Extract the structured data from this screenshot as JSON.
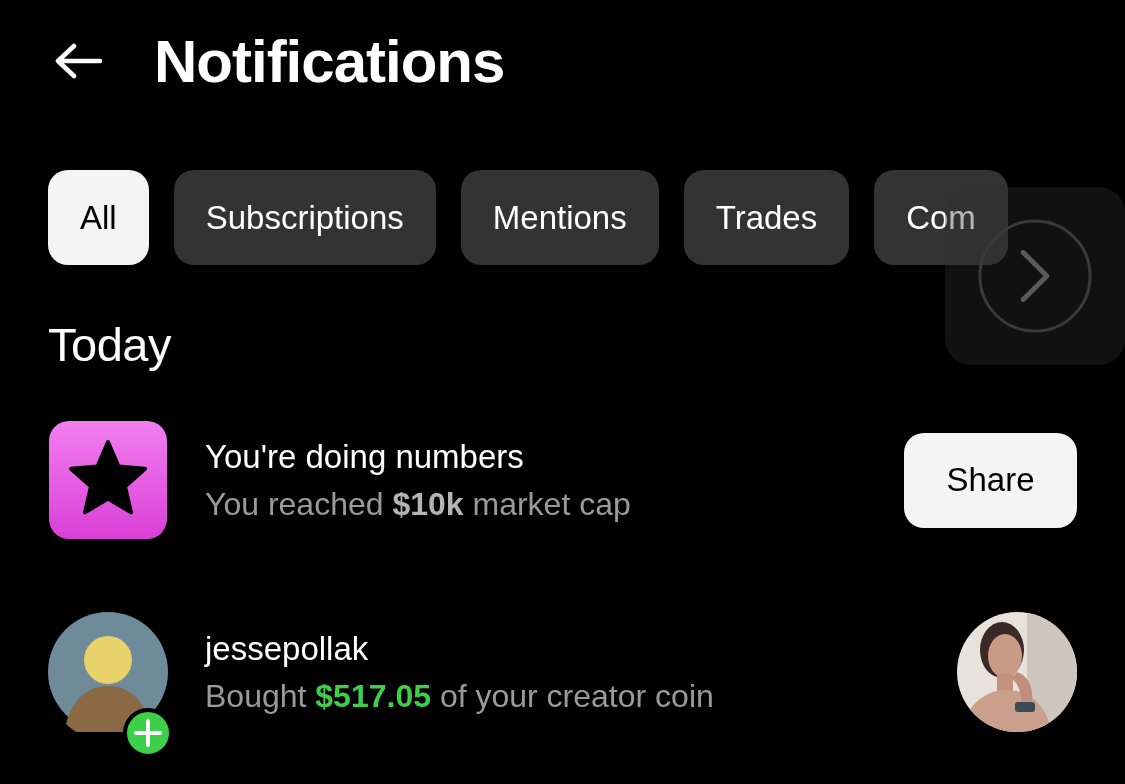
{
  "header": {
    "title": "Notifications"
  },
  "tabs": [
    {
      "label": "All",
      "selected": true
    },
    {
      "label": "Subscriptions",
      "selected": false
    },
    {
      "label": "Mentions",
      "selected": false
    },
    {
      "label": "Trades",
      "selected": false
    },
    {
      "label": "Com",
      "selected": false
    }
  ],
  "section": {
    "title": "Today"
  },
  "notifications": [
    {
      "kind": "milestone",
      "title": "You're doing numbers",
      "detail": [
        {
          "kind": "plain",
          "text": "You reached "
        },
        {
          "kind": "bold",
          "text": "$10k"
        },
        {
          "kind": "plain",
          "text": " market cap"
        }
      ],
      "action": "Share"
    },
    {
      "kind": "trade",
      "title": "jessepollak",
      "detail": [
        {
          "kind": "plain",
          "text": "Bought "
        },
        {
          "kind": "amount",
          "text": "$517.05"
        },
        {
          "kind": "plain",
          "text": " of your creator coin"
        }
      ]
    }
  ]
}
